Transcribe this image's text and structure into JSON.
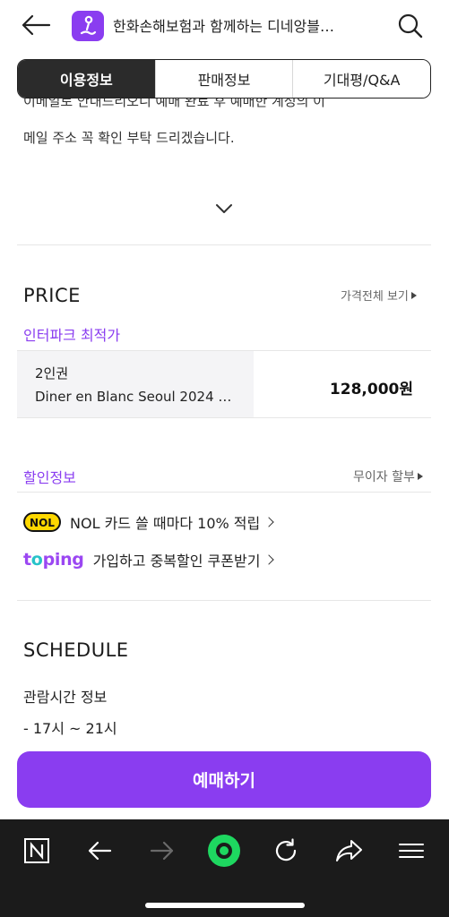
{
  "header": {
    "title": "한화손해보험과 함께하는 디네앙블…"
  },
  "tabs": [
    {
      "label": "이용정보",
      "active": true
    },
    {
      "label": "판매정보",
      "active": false
    },
    {
      "label": "기대평/Q&A",
      "active": false
    }
  ],
  "notice": {
    "cut_line": "이메일로 안내드리오니 예매 완료 후 예매한 계정의 이",
    "line": "메일 주소 꼭 확인 부탁 드리겠습니다."
  },
  "price": {
    "title": "PRICE",
    "view_all": "가격전체 보기",
    "site_label": "인터파크 최적가",
    "grade": "2인권",
    "product": "Diner en Blanc Seoul 2024 …",
    "amount": "128,000원"
  },
  "discount": {
    "title": "할인정보",
    "installment": "무이자 할부",
    "promos": [
      {
        "logo": "NOL",
        "text": "NOL 카드 쓸 때마다 10% 적립"
      },
      {
        "logo": "toping",
        "text": "가입하고 중복할인 쿠폰받기"
      }
    ]
  },
  "schedule": {
    "title": "SCHEDULE",
    "label": "관람시간 정보",
    "time": "- 17시 ~ 21시"
  },
  "book_button": "예매하기",
  "colors": {
    "accent": "#8a3df0",
    "tab_active": "#2b2b2b",
    "bottom_bar": "#1b1b1b",
    "home_green": "#1ed760"
  },
  "icons": [
    "back-arrow-icon",
    "app-logo-icon",
    "search-icon",
    "chevron-down-icon",
    "naver-n-icon",
    "browser-back-icon",
    "browser-forward-icon",
    "home-circle-icon",
    "refresh-icon",
    "share-icon",
    "menu-icon"
  ]
}
